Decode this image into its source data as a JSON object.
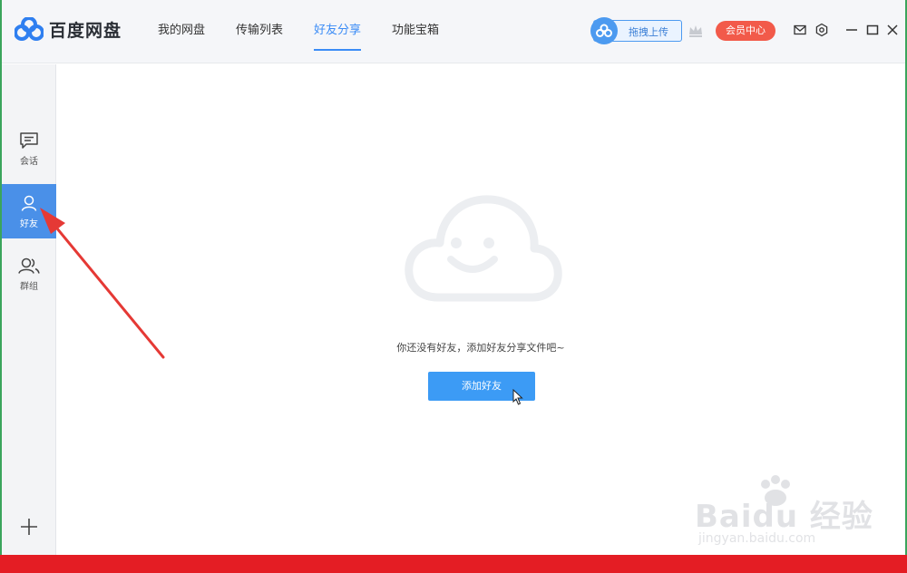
{
  "app": {
    "name": "百度网盘",
    "brand_color": "#3b8cf6"
  },
  "nav": {
    "tabs": [
      {
        "label": "我的网盘",
        "active": false
      },
      {
        "label": "传输列表",
        "active": false
      },
      {
        "label": "好友分享",
        "active": true
      },
      {
        "label": "功能宝箱",
        "active": false
      }
    ]
  },
  "toolbar": {
    "upload_label": "拖拽上传",
    "vip_label": "会员中心",
    "vip_color": "#f25a4a",
    "icons": [
      "cloud-icon",
      "crown-icon",
      "mail-icon",
      "settings-icon",
      "minimize-icon",
      "maximize-icon",
      "close-icon"
    ]
  },
  "sidebar": {
    "items": [
      {
        "label": "会话",
        "icon": "chat-icon",
        "active": false
      },
      {
        "label": "好友",
        "icon": "user-icon",
        "active": true
      },
      {
        "label": "群组",
        "icon": "group-icon",
        "active": false
      }
    ],
    "add_icon": "plus-icon"
  },
  "main": {
    "empty_message": "你还没有好友，添加好友分享文件吧~",
    "add_button_label": "添加好友"
  },
  "watermark": {
    "main": "Baidu 经验",
    "sub": "jingyan.baidu.com"
  }
}
